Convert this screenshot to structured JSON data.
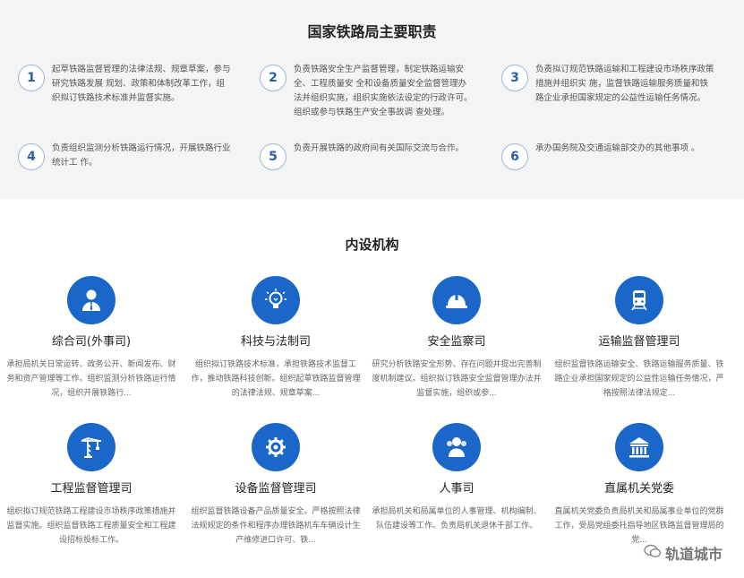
{
  "duties": {
    "title": "国家铁路局主要职责",
    "items": [
      {
        "num": "1",
        "text": "起草铁路监督管理的法律法规、规章草案，参与研究铁路发展 规划、政策和体制改革工作，组织拟订铁路技术标准并监督实施。"
      },
      {
        "num": "2",
        "text": "负责铁路安全生产监督管理，制定铁路运输安全、工程质量安 全和设备质量安全监督管理办法并组织实施，组织实施依法设定的行政许可。组织或参与铁路生产安全事故调 查处理。"
      },
      {
        "num": "3",
        "text": "负责拟订规范铁路运输和工程建设市场秩序政策措施并组织实 施，监督铁路运输服务质量和铁路企业承担国家规定的公益性运输任务情况。"
      },
      {
        "num": "4",
        "text": "负责组织监测分析铁路运行情况，开展铁路行业统计工 作。"
      },
      {
        "num": "5",
        "text": "负责开展铁路的政府间有关国际交流与合作。"
      },
      {
        "num": "6",
        "text": "承办国务院及交通运输部交办的其他事项 。"
      }
    ]
  },
  "departments": {
    "title": "内设机构",
    "items": [
      {
        "name": "综合司(外事司)",
        "icon": "person-tie-icon",
        "desc": "承担局机关日常运转、政务公开、新闻发布、财务和资产管理等工作。组织监测分析铁路运行情况，组织开展铁路行..."
      },
      {
        "name": "科技与法制司",
        "icon": "lightbulb-icon",
        "desc": "组织拟订铁路技术标准，承担铁路技术监督工作，推动铁路科技创新。组织起草铁路监督管理的法律法规、规章草案..."
      },
      {
        "name": "安全监察司",
        "icon": "hardhat-icon",
        "desc": "研究分析铁路安全形势、存在问题并提出完善制度机制建议。组织拟订铁路安全监督管理办法并监督实施，组织或参..."
      },
      {
        "name": "运输监督管理司",
        "icon": "train-icon",
        "desc": "组织监督铁路运输安全、铁路运输服务质量、铁路企业承担国家规定的公益性运输任务情况，严格按照法律法规定..."
      },
      {
        "name": "工程监督管理司",
        "icon": "crane-icon",
        "desc": "组织拟订规范铁路工程建设市场秩序政策措施并监督实施。组织监督铁路工程质量安全和工程建设招标投标工作。"
      },
      {
        "name": "设备监督管理司",
        "icon": "gear-wrench-icon",
        "desc": "组织监督铁路设备产品质量安全。严格按照法律法规规定的条件和程序办理铁路机车车辆设计生产维修进口许可、铁..."
      },
      {
        "name": "人事司",
        "icon": "people-icon",
        "desc": "承担局机关和局属单位的人事管理、机构编制、队伍建设等工作。负责局机关退休干部工作。"
      },
      {
        "name": "直属机关党委",
        "icon": "building-icon",
        "desc": "直属机关党委负责局机关和局属事业单位的党群工作，受局党组委托指导地区铁路监督管理局的党..."
      }
    ]
  },
  "watermark": {
    "text": "轨道城市",
    "icon": "wechat-icon"
  },
  "colors": {
    "accent": "#1b66c9",
    "panel": "#f4f4f4"
  }
}
